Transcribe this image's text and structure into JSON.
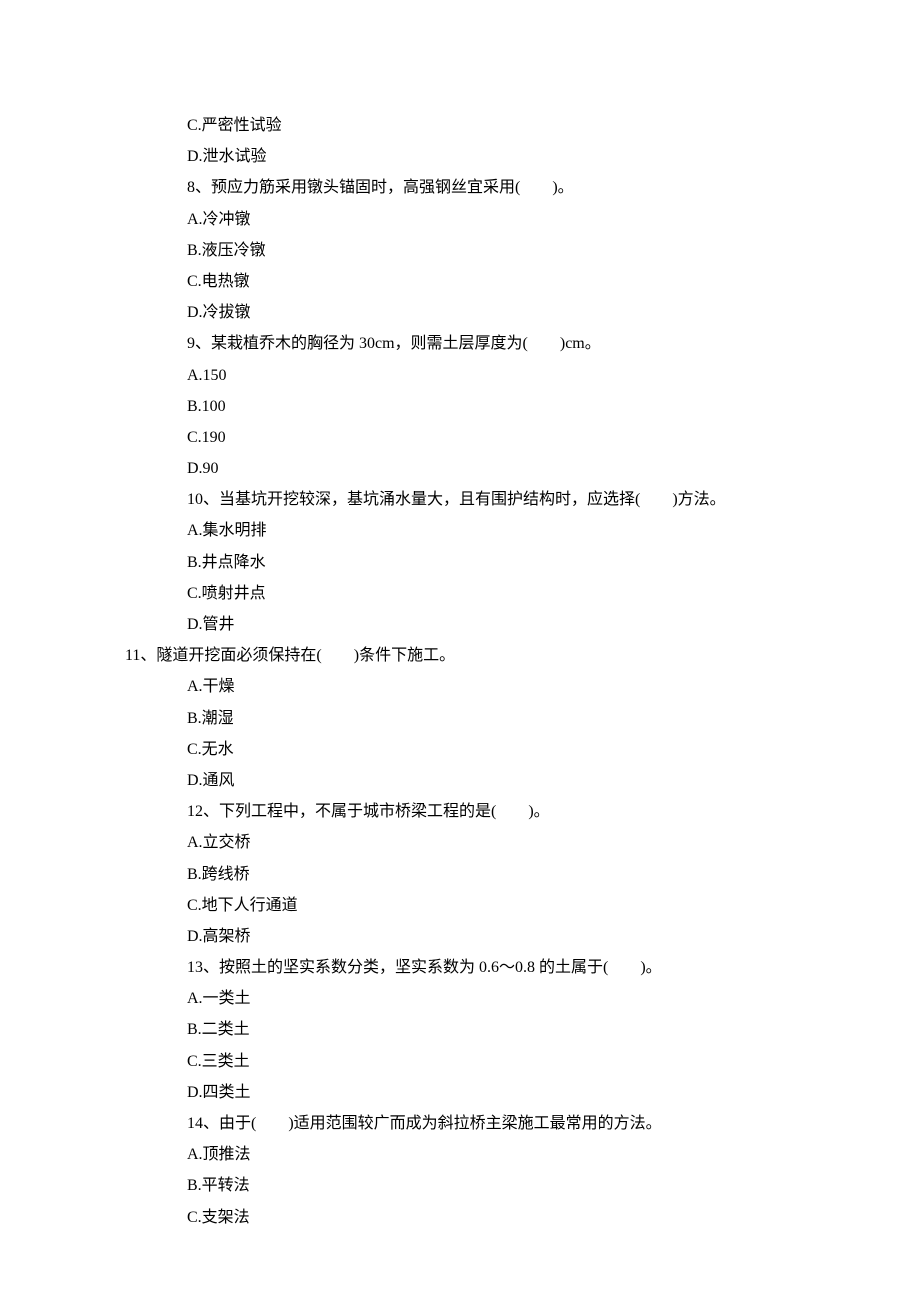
{
  "lines": [
    {
      "indent": 1,
      "text": "C.严密性试验"
    },
    {
      "indent": 1,
      "text": "D.泄水试验"
    },
    {
      "indent": 1,
      "text": "8、预应力筋采用镦头锚固时，高强钢丝宜采用(　　)。"
    },
    {
      "indent": 1,
      "text": "A.冷冲镦"
    },
    {
      "indent": 1,
      "text": "B.液压冷镦"
    },
    {
      "indent": 1,
      "text": "C.电热镦"
    },
    {
      "indent": 1,
      "text": "D.冷拔镦"
    },
    {
      "indent": 1,
      "text": "9、某栽植乔木的胸径为 30cm，则需土层厚度为(　　)cm。"
    },
    {
      "indent": 1,
      "text": "A.150"
    },
    {
      "indent": 1,
      "text": "B.100"
    },
    {
      "indent": 1,
      "text": "C.190"
    },
    {
      "indent": 1,
      "text": "D.90"
    },
    {
      "indent": 1,
      "text": "10、当基坑开挖较深，基坑涌水量大，且有围护结构时，应选择(　　)方法。"
    },
    {
      "indent": 1,
      "text": "A.集水明排"
    },
    {
      "indent": 1,
      "text": "B.井点降水"
    },
    {
      "indent": 1,
      "text": "C.喷射井点"
    },
    {
      "indent": 1,
      "text": "D.管井"
    },
    {
      "indent": 0,
      "text": "11、隧道开挖面必须保持在(　　)条件下施工。"
    },
    {
      "indent": 1,
      "text": "A.干燥"
    },
    {
      "indent": 1,
      "text": "B.潮湿"
    },
    {
      "indent": 1,
      "text": "C.无水"
    },
    {
      "indent": 1,
      "text": "D.通风"
    },
    {
      "indent": 1,
      "text": "12、下列工程中，不属于城市桥梁工程的是(　　)。"
    },
    {
      "indent": 1,
      "text": "A.立交桥"
    },
    {
      "indent": 1,
      "text": "B.跨线桥"
    },
    {
      "indent": 1,
      "text": "C.地下人行通道"
    },
    {
      "indent": 1,
      "text": "D.高架桥"
    },
    {
      "indent": 1,
      "text": "13、按照土的坚实系数分类，坚实系数为 0.6～0.8 的土属于(　　)。"
    },
    {
      "indent": 1,
      "text": "A.一类土"
    },
    {
      "indent": 1,
      "text": "B.二类土"
    },
    {
      "indent": 1,
      "text": "C.三类土"
    },
    {
      "indent": 1,
      "text": "D.四类土"
    },
    {
      "indent": 1,
      "text": "14、由于(　　)适用范围较广而成为斜拉桥主梁施工最常用的方法。"
    },
    {
      "indent": 1,
      "text": "A.顶推法"
    },
    {
      "indent": 1,
      "text": "B.平转法"
    },
    {
      "indent": 1,
      "text": "C.支架法"
    }
  ]
}
